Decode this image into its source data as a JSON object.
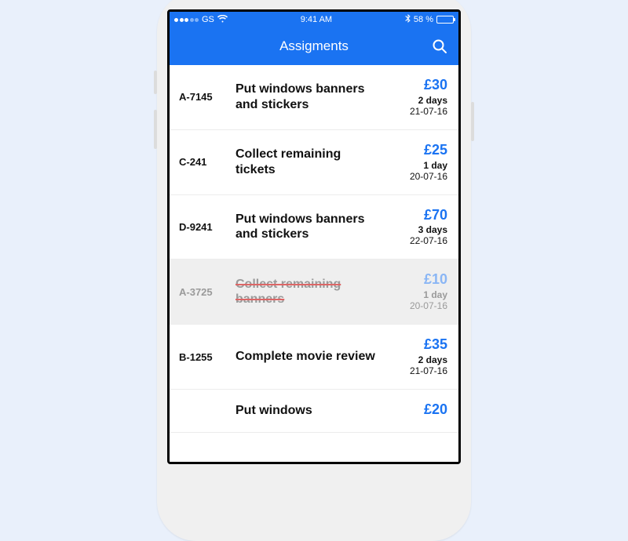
{
  "status": {
    "carrier": "GS",
    "time": "9:41 AM",
    "battery_pct": "58 %"
  },
  "nav": {
    "title": "Assigments"
  },
  "assignments": [
    {
      "code": "A-7145",
      "title": "Put windows banners and stickers",
      "price": "£30",
      "duration": "2 days",
      "date": "21-07-16",
      "completed": false
    },
    {
      "code": "C-241",
      "title": "Collect remaining tickets",
      "price": "£25",
      "duration": "1 day",
      "date": "20-07-16",
      "completed": false
    },
    {
      "code": "D-9241",
      "title": "Put windows banners and stickers",
      "price": "£70",
      "duration": "3 days",
      "date": "22-07-16",
      "completed": false
    },
    {
      "code": "A-3725",
      "title": "Collect remaining banners",
      "price": "£10",
      "duration": "1 day",
      "date": "20-07-16",
      "completed": true
    },
    {
      "code": "B-1255",
      "title": "Complete movie review",
      "price": "£35",
      "duration": "2 days",
      "date": "21-07-16",
      "completed": false
    },
    {
      "code": "",
      "title": "Put windows",
      "price": "£20",
      "duration": "",
      "date": "",
      "completed": false
    }
  ]
}
